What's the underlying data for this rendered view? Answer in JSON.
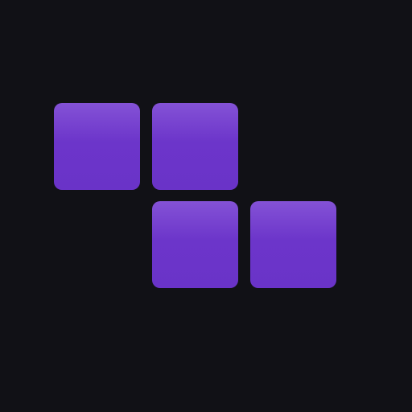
{
  "game": {
    "piece": {
      "shape": "Z-tetromino",
      "orientation": "horizontal",
      "cells": [
        {
          "row": 0,
          "col": 0
        },
        {
          "row": 0,
          "col": 1
        },
        {
          "row": 1,
          "col": 1
        },
        {
          "row": 1,
          "col": 2
        }
      ]
    }
  },
  "colors": {
    "background": "#111116",
    "block_top": "#8452d6",
    "block_mid": "#6c35ca",
    "block_bottom": "#6a33c8"
  }
}
